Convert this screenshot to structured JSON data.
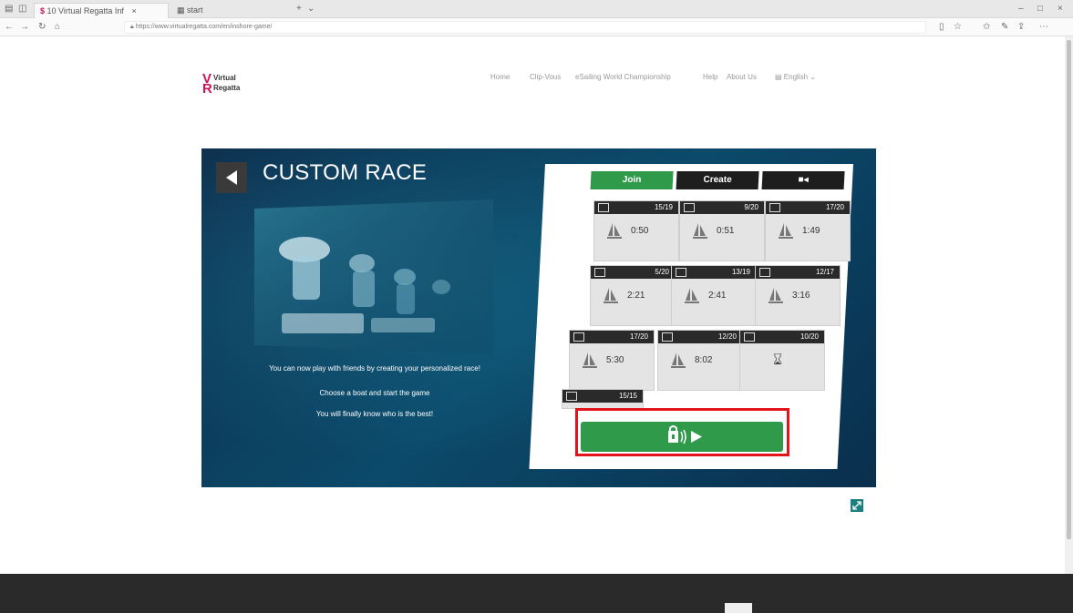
{
  "browser": {
    "tabs": [
      {
        "label": "10 Virtual Regatta Inf",
        "active": true
      },
      {
        "label": "start",
        "active": false
      }
    ],
    "url": "https://www.virtualregatta.com/en/inshore-game/",
    "window_controls": [
      "minimize-icon",
      "maximize-icon",
      "close-icon"
    ]
  },
  "site": {
    "logo": {
      "line1": "Virtual",
      "line2": "Regatta"
    },
    "nav": [
      "Home",
      "Clip-Vous",
      "eSailing World Championship",
      "Help",
      "About Us",
      "English"
    ]
  },
  "game": {
    "title": "CUSTOM RACE",
    "description": [
      "You can now play with friends by creating your personalized race!",
      "Choose a boat and start the game",
      "You will finally know who is the best!"
    ],
    "tabs": [
      {
        "label": "Join",
        "active": true
      },
      {
        "label": "Create",
        "active": false
      },
      {
        "label": "",
        "icon": "video-camera-icon",
        "active": false
      }
    ],
    "races": [
      {
        "count": "15/19",
        "time": "0:50"
      },
      {
        "count": "9/20",
        "time": "0:51"
      },
      {
        "count": "17/20",
        "time": "1:49"
      },
      {
        "count": "5/20",
        "time": "2:21"
      },
      {
        "count": "13/19",
        "time": "2:41"
      },
      {
        "count": "12/17",
        "time": "3:16"
      },
      {
        "count": "17/20",
        "time": "5:30"
      },
      {
        "count": "12/20",
        "time": "8:02"
      },
      {
        "count": "10/20",
        "time": "",
        "icon": "hourglass-icon"
      },
      {
        "count": "15/15",
        "time": ""
      }
    ],
    "play_button": {
      "icons": [
        "private-lock-icon",
        "play-icon"
      ]
    }
  },
  "colors": {
    "accent_green": "#2e9a4a",
    "highlight_red": "#e3141b",
    "brand_pink": "#c8155a"
  }
}
